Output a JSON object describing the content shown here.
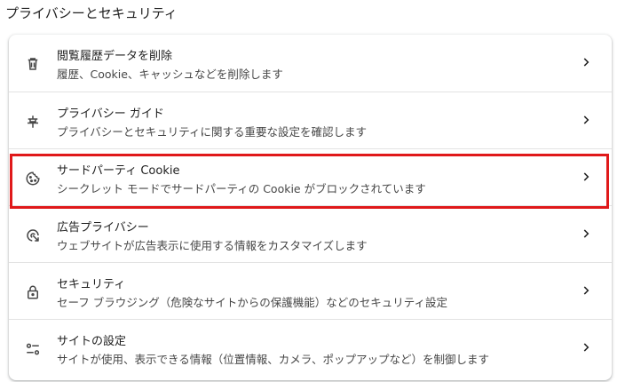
{
  "section_title": "プライバシーとセキュリティ",
  "rows": [
    {
      "icon": "trash-icon",
      "title": "閲覧履歴データを削除",
      "subtitle": "履歴、Cookie、キャッシュなどを削除します"
    },
    {
      "icon": "privacy-guide-icon",
      "title": "プライバシー ガイド",
      "subtitle": "プライバシーとセキュリティに関する重要な設定を確認します"
    },
    {
      "icon": "cookie-icon",
      "title": "サードパーティ Cookie",
      "subtitle": "シークレット モードでサードパーティの Cookie がブロックされています"
    },
    {
      "icon": "ad-privacy-icon",
      "title": "広告プライバシー",
      "subtitle": "ウェブサイトが広告表示に使用する情報をカスタマイズします"
    },
    {
      "icon": "lock-icon",
      "title": "セキュリティ",
      "subtitle": "セーフ ブラウジング（危険なサイトからの保護機能）などのセキュリティ設定"
    },
    {
      "icon": "site-settings-icon",
      "title": "サイトの設定",
      "subtitle": "サイトが使用、表示できる情報（位置情報、カメラ、ポップアップなど）を制御します"
    }
  ],
  "colors": {
    "highlight": "#e0191a",
    "icon": "#474747",
    "divider": "#e3e3e3"
  }
}
